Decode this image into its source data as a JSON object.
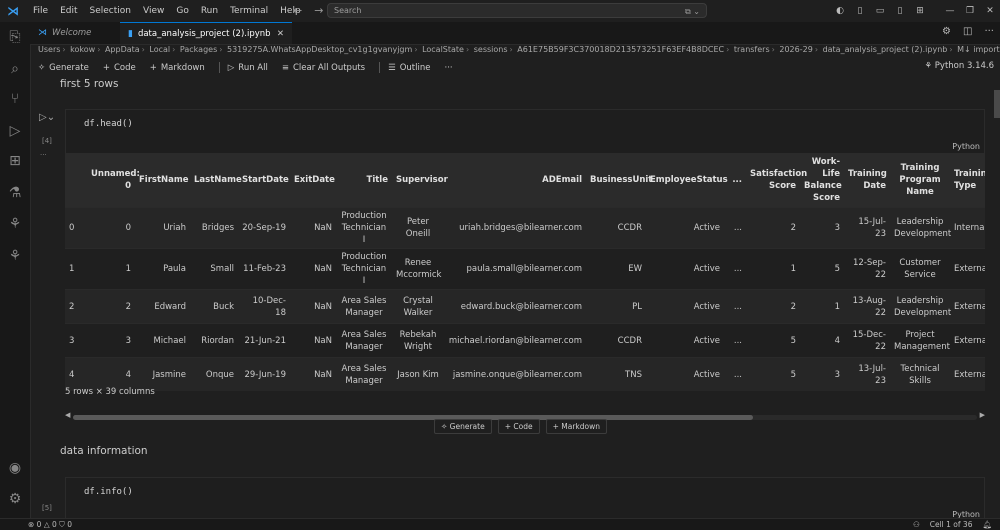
{
  "titlebar": {
    "menu": [
      "File",
      "Edit",
      "Selection",
      "View",
      "Go",
      "Run",
      "Terminal",
      "Help"
    ],
    "search_placeholder": "Search",
    "back_glyph": "←",
    "forward_glyph": "→"
  },
  "tabs": [
    {
      "label": "Welcome"
    },
    {
      "label": "data_analysis_project (2).ipynb"
    }
  ],
  "breadcrumb": [
    "Users",
    "kokow",
    "AppData",
    "Local",
    "Packages",
    "5319275A.WhatsAppDesktop_cv1g1gvanyjgm",
    "LocalState",
    "sessions",
    "A61E75B59F3C370018D213573251F63EF4B8DCEC",
    "transfers",
    "2026-29",
    "data_analysis_project (2).ipynb",
    "M↓ import the libraries"
  ],
  "toolbar": {
    "generate": "Generate",
    "code": "Code",
    "markdown": "Markdown",
    "run_all": "Run All",
    "clear_outputs": "Clear All Outputs",
    "outline": "Outline",
    "more": "···",
    "kernel": "Python 3.14.6"
  },
  "cells": {
    "md1": "first 5 rows",
    "c1_count": "[4]",
    "c1_code": "df.head()",
    "c1_lang": "Python",
    "md2": "data information",
    "c2_count": "[5]",
    "c2_code": "df.info()",
    "c2_lang": "Python"
  },
  "table": {
    "columns": [
      "",
      "Unnamed: 0",
      "FirstName",
      "LastName",
      "StartDate",
      "ExitDate",
      "Title",
      "Supervisor",
      "ADEmail",
      "BusinessUnit",
      "EmployeeStatus",
      "...",
      "Satisfaction Score",
      "Work-Life Balance Score",
      "Training Date",
      "Training Program Name",
      "Training Type"
    ],
    "rows": [
      [
        "0",
        "0",
        "Uriah",
        "Bridges",
        "20-Sep-19",
        "NaN",
        "Production Technician I",
        "Peter Oneill",
        "uriah.bridges@bilearner.com",
        "CCDR",
        "Active",
        "...",
        "2",
        "3",
        "15-Jul-23",
        "Leadership Development",
        "Internal"
      ],
      [
        "1",
        "1",
        "Paula",
        "Small",
        "11-Feb-23",
        "NaN",
        "Production Technician I",
        "Renee Mccormick",
        "paula.small@bilearner.com",
        "EW",
        "Active",
        "...",
        "1",
        "5",
        "12-Sep-22",
        "Customer Service",
        "External"
      ],
      [
        "2",
        "2",
        "Edward",
        "Buck",
        "10-Dec-18",
        "NaN",
        "Area Sales Manager",
        "Crystal Walker",
        "edward.buck@bilearner.com",
        "PL",
        "Active",
        "...",
        "2",
        "1",
        "13-Aug-22",
        "Leadership Development",
        "External"
      ],
      [
        "3",
        "3",
        "Michael",
        "Riordan",
        "21-Jun-21",
        "NaN",
        "Area Sales Manager",
        "Rebekah Wright",
        "michael.riordan@bilearner.com",
        "CCDR",
        "Active",
        "...",
        "5",
        "4",
        "15-Dec-22",
        "Project Management",
        "External"
      ],
      [
        "4",
        "4",
        "Jasmine",
        "Onque",
        "29-Jun-19",
        "NaN",
        "Area Sales Manager",
        "Jason Kim",
        "jasmine.onque@bilearner.com",
        "TNS",
        "Active",
        "...",
        "5",
        "3",
        "13-Jul-23",
        "Technical Skills",
        "External"
      ]
    ],
    "shape": "5 rows × 39 columns"
  },
  "insert_bar": {
    "generate": "Generate",
    "code": "Code",
    "markdown": "Markdown"
  },
  "status": {
    "errors": "0",
    "warnings": "0",
    "ports": "0",
    "cell_position": "Cell 1 of 36"
  }
}
